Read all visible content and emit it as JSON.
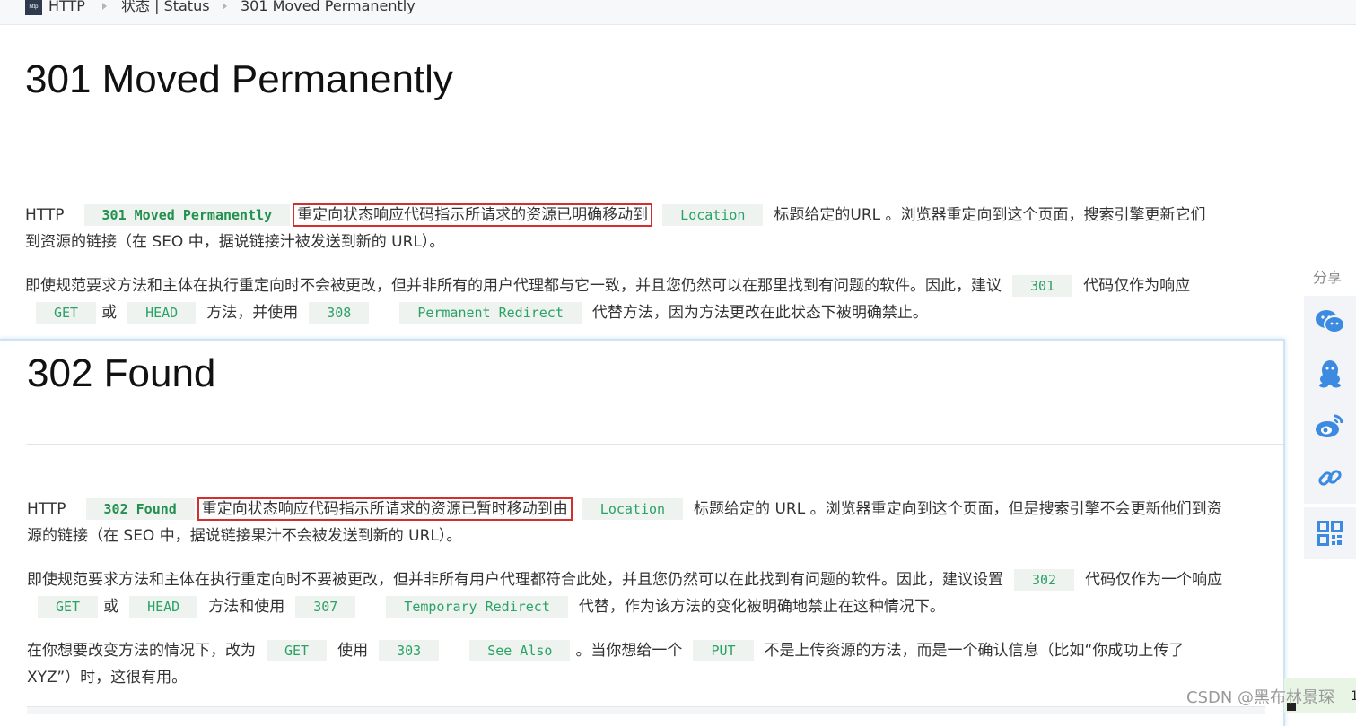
{
  "breadcrumb": {
    "logo_text": "http",
    "items": [
      "HTTP",
      "状态 | Status",
      "301 Moved Permanently"
    ]
  },
  "section301": {
    "title": "301 Moved Permanently",
    "p1": {
      "t1": "HTTP",
      "code1": "301 Moved Permanently",
      "highlight": "重定向状态响应代码指示所请求的资源已明确移动到",
      "code2": "Location",
      "t2": "标题给定的URL 。浏览器重定向到这个页面，搜索引擎更新它们",
      "line2": "到资源的链接（在 SEO 中，据说链接汁被发送到新的 URL）。"
    },
    "p2": {
      "t1": "即使规范要求方法和主体在执行重定向时不会被更改，但并非所有的用户代理都与它一致，并且您仍然可以在那里找到有问题的软件。因此，建议",
      "code1": "301",
      "t2": "代码仅作为响应",
      "code2": "GET",
      "t3": "或",
      "code3": "HEAD",
      "t4": "方法，并使用",
      "code4": "308",
      "code5": "Permanent Redirect",
      "t5": "代替方法，因为方法更改在此状态下被明确禁止。"
    }
  },
  "section302": {
    "title": "302 Found",
    "p1": {
      "t1": "HTTP",
      "code1": "302 Found",
      "highlight": "重定向状态响应代码指示所请求的资源已暂时移动到由",
      "code2": "Location",
      "t2": "标题给定的 URL 。浏览器重定向到这个页面，但是搜索引擎不会更新他们到资",
      "line2": "源的链接（在 SEO 中，据说链接果汁不会被发送到新的 URL）。"
    },
    "p2": {
      "t1": "即使规范要求方法和主体在执行重定向时不要被更改，但并非所有用户代理都符合此处，并且您仍然可以在此找到有问题的软件。因此，建议设置",
      "code1": "302",
      "t2": "代码仅作为一个响应",
      "code2": "GET",
      "t3": "或",
      "code3": "HEAD",
      "t4": "方法和使用",
      "code4": "307",
      "code5": "Temporary Redirect",
      "t5": "代替，作为该方法的变化被明确地禁止在这种情况下。"
    },
    "p3": {
      "t1": "在你想要改变方法的情况下，改为",
      "code1": "GET",
      "t2": "使用",
      "code2": "303",
      "code3": "See Also",
      "t3": "。当你想给一个",
      "code4": "PUT",
      "t4": "不是上传资源的方法，而是一个确认信息（比如“你成功上传了",
      "line2": "XYZ”）时，这很有用。"
    }
  },
  "share": {
    "label": "分享",
    "buttons": [
      "wechat-icon",
      "qq-icon",
      "weibo-icon",
      "link-icon",
      "qrcode-icon"
    ]
  },
  "watermark": "CSDN @黑布林景琛",
  "corner_text": "1",
  "colors": {
    "code_bg": "#eef3ef",
    "code_fg": "#2aa266",
    "highlight_border": "#d32f2f",
    "share_icon": "#3d8be0"
  }
}
